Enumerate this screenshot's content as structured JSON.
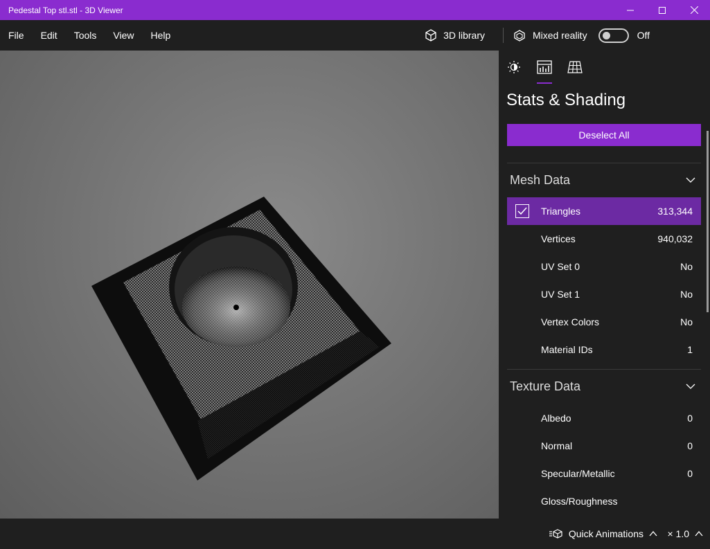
{
  "window": {
    "title": "Pedestal Top stl.stl - 3D Viewer"
  },
  "menu": {
    "items": [
      "File",
      "Edit",
      "Tools",
      "View",
      "Help"
    ]
  },
  "toolbar": {
    "library_label": "3D library",
    "mixed_reality_label": "Mixed reality",
    "mixed_reality_state": "Off"
  },
  "panel": {
    "title": "Stats & Shading",
    "deselect_label": "Deselect All",
    "mesh_section": "Mesh Data",
    "mesh_rows": [
      {
        "label": "Triangles",
        "value": "313,344"
      },
      {
        "label": "Vertices",
        "value": "940,032"
      },
      {
        "label": "UV Set 0",
        "value": "No"
      },
      {
        "label": "UV Set 1",
        "value": "No"
      },
      {
        "label": "Vertex Colors",
        "value": "No"
      },
      {
        "label": "Material IDs",
        "value": "1"
      }
    ],
    "texture_section": "Texture Data",
    "texture_rows": [
      {
        "label": "Albedo",
        "value": "0"
      },
      {
        "label": "Normal",
        "value": "0"
      },
      {
        "label": "Specular/Metallic",
        "value": "0"
      },
      {
        "label": "Gloss/Roughness",
        "value": ""
      }
    ]
  },
  "bottom": {
    "quick_animations_label": "Quick Animations",
    "speed_label": "× 1.0"
  },
  "colors": {
    "accent": "#8a2ccf",
    "selected_row": "#6c2aa3",
    "background": "#1f1f1f"
  }
}
